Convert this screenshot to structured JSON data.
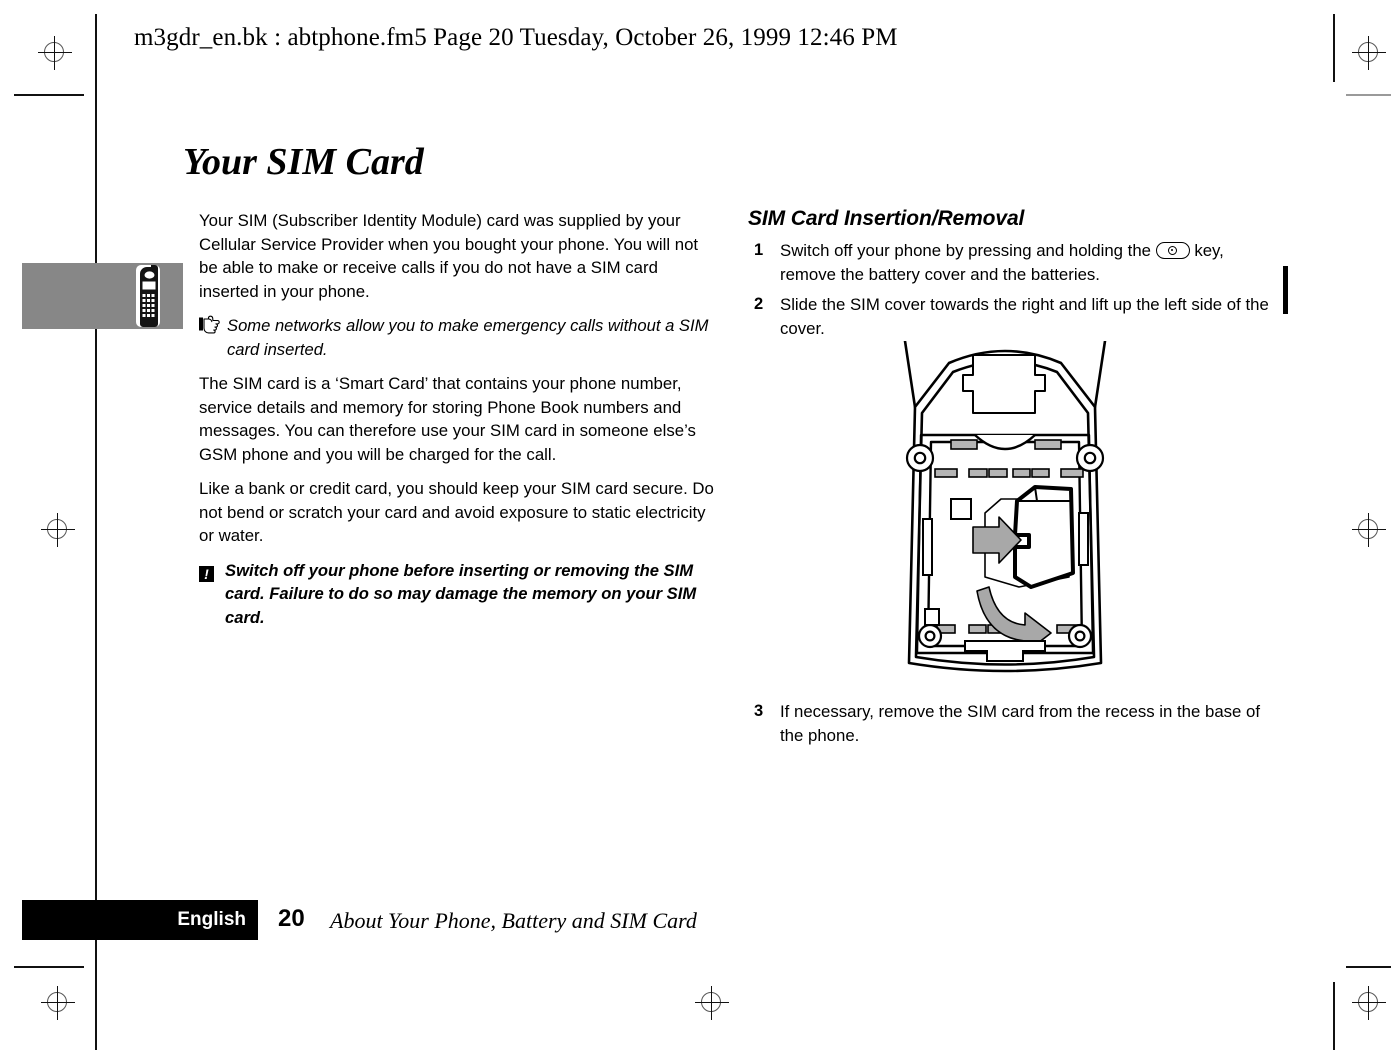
{
  "header": {
    "running_text": "m3gdr_en.bk : abtphone.fm5  Page 20  Tuesday, October 26, 1999  12:46 PM"
  },
  "page": {
    "chapter_title": "Your SIM Card"
  },
  "left_column": {
    "paragraph_1": "Your SIM (Subscriber Identity Module) card was supplied by your Cellular Service Provider when you bought your phone. You will not be able to make or receive calls if you do not have a SIM card inserted in your phone.",
    "note_1": "Some networks allow you to make emergency calls without a SIM card inserted.",
    "paragraph_2": "The SIM card is a ‘Smart Card’ that contains your phone number, service details and memory for storing Phone Book numbers and messages. You can therefore use your SIM card in someone else’s GSM phone and you will be charged for the call.",
    "paragraph_3": "Like a bank or credit card, you should keep your SIM card secure. Do not bend or scratch your card and avoid exposure to static electricity or water.",
    "warning_1": "Switch off your phone before inserting or removing the SIM card. Failure to do so may damage the memory on your SIM card.",
    "note_icon_name": "pointing-hand-icon",
    "warning_icon_name": "exclamation-warning-icon",
    "warning_icon_char": "!"
  },
  "right_column": {
    "section_heading": "SIM Card Insertion/Removal",
    "steps": [
      {
        "number": "1",
        "text_before_key": "Switch off your phone by pressing and holding the ",
        "text_after_key": " key, remove the battery cover and the batteries.",
        "key_icon_name": "power-key-icon"
      },
      {
        "number": "2",
        "text": "Slide the SIM cover towards the right and lift up the left side of the cover."
      },
      {
        "number": "3",
        "text": "If necessary, remove the SIM card from the recess in the base of the phone."
      }
    ],
    "illustration_name": "phone-back-sim-cover-diagram",
    "illustration_caption": ""
  },
  "side_tab": {
    "icon_name": "mobile-phone-icon",
    "background_color": "#878787"
  },
  "footer": {
    "language": "English",
    "page_number": "20",
    "running_title": "About Your Phone, Battery and SIM Card",
    "box_color": "#000000"
  },
  "printer_marks": {
    "registration_icon_name": "registration-target-icon",
    "crop_icon_name": "crop-mark"
  },
  "colors": {
    "ink": "#000000",
    "paper": "#ffffff",
    "tab_gray": "#878787",
    "diagram_fill": "#9e9e9e"
  }
}
